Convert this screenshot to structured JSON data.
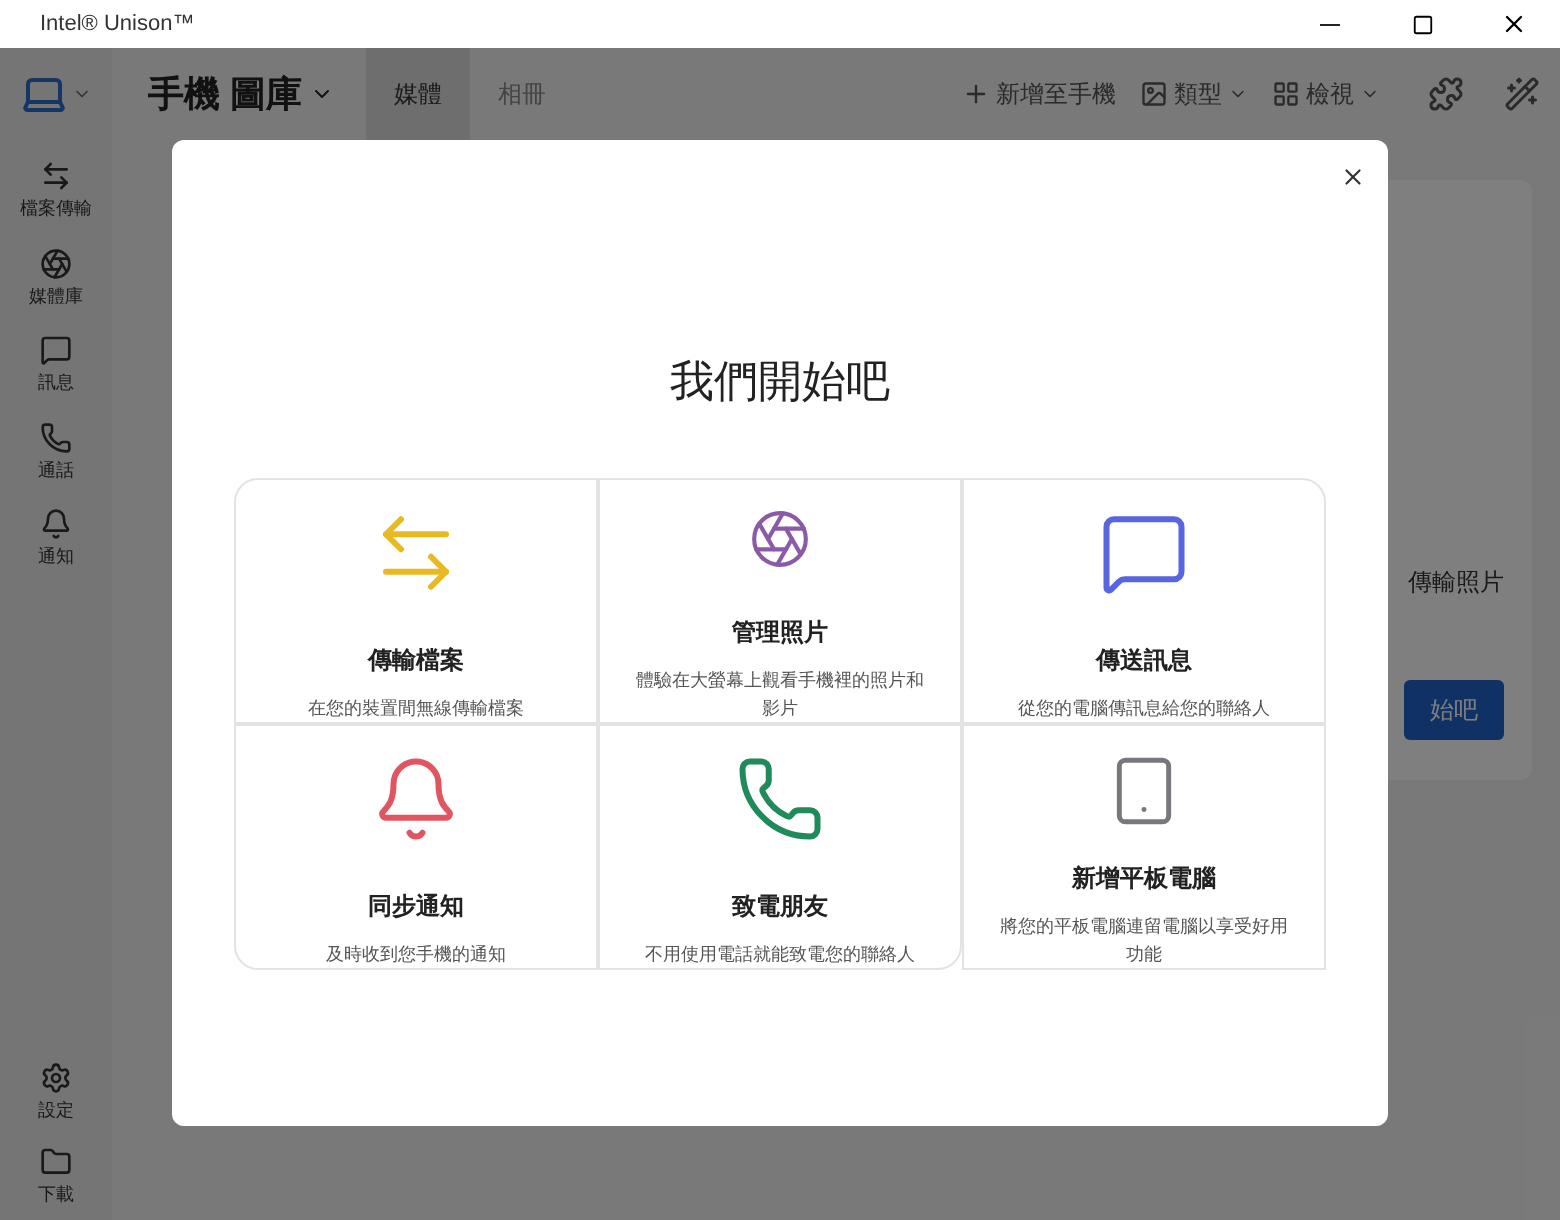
{
  "window": {
    "title": "Intel® Unison™"
  },
  "header": {
    "title": "手機 圖庫",
    "tabs": [
      {
        "label": "媒體",
        "selected": true
      },
      {
        "label": "相冊",
        "selected": false
      }
    ],
    "actions": [
      {
        "label": "新增至手機",
        "kind": "add"
      },
      {
        "label": "類型",
        "kind": "type"
      },
      {
        "label": "檢視",
        "kind": "view"
      }
    ]
  },
  "sidebar": {
    "items": [
      {
        "label": "檔案傳輸"
      },
      {
        "label": "媒體庫"
      },
      {
        "label": "訊息"
      },
      {
        "label": "通話"
      },
      {
        "label": "通知"
      }
    ],
    "bottom_items": [
      {
        "label": "設定"
      },
      {
        "label": "下載"
      }
    ]
  },
  "background_card": {
    "text": "傳輸照片",
    "button": "始吧"
  },
  "dialog": {
    "title": "我們開始吧",
    "features": [
      {
        "title": "傳輸檔案",
        "description": "在您的裝置間無線傳輸檔案",
        "color": "#e8b923"
      },
      {
        "title": "管理照片",
        "description": "體驗在大螢幕上觀看手機裡的照片和影片",
        "color": "#8a5aa8"
      },
      {
        "title": "傳送訊息",
        "description": "從您的電腦傳訊息給您的聯絡人",
        "color": "#5865e0"
      },
      {
        "title": "同步通知",
        "description": "及時收到您手機的通知",
        "color": "#e05560"
      },
      {
        "title": "致電朋友",
        "description": "不用使用電話就能致電您的聯絡人",
        "color": "#1f8a5a"
      },
      {
        "title": "新增平板電腦",
        "description": "將您的平板電腦連留電腦以享受好用功能",
        "color": "#77777d"
      }
    ]
  }
}
